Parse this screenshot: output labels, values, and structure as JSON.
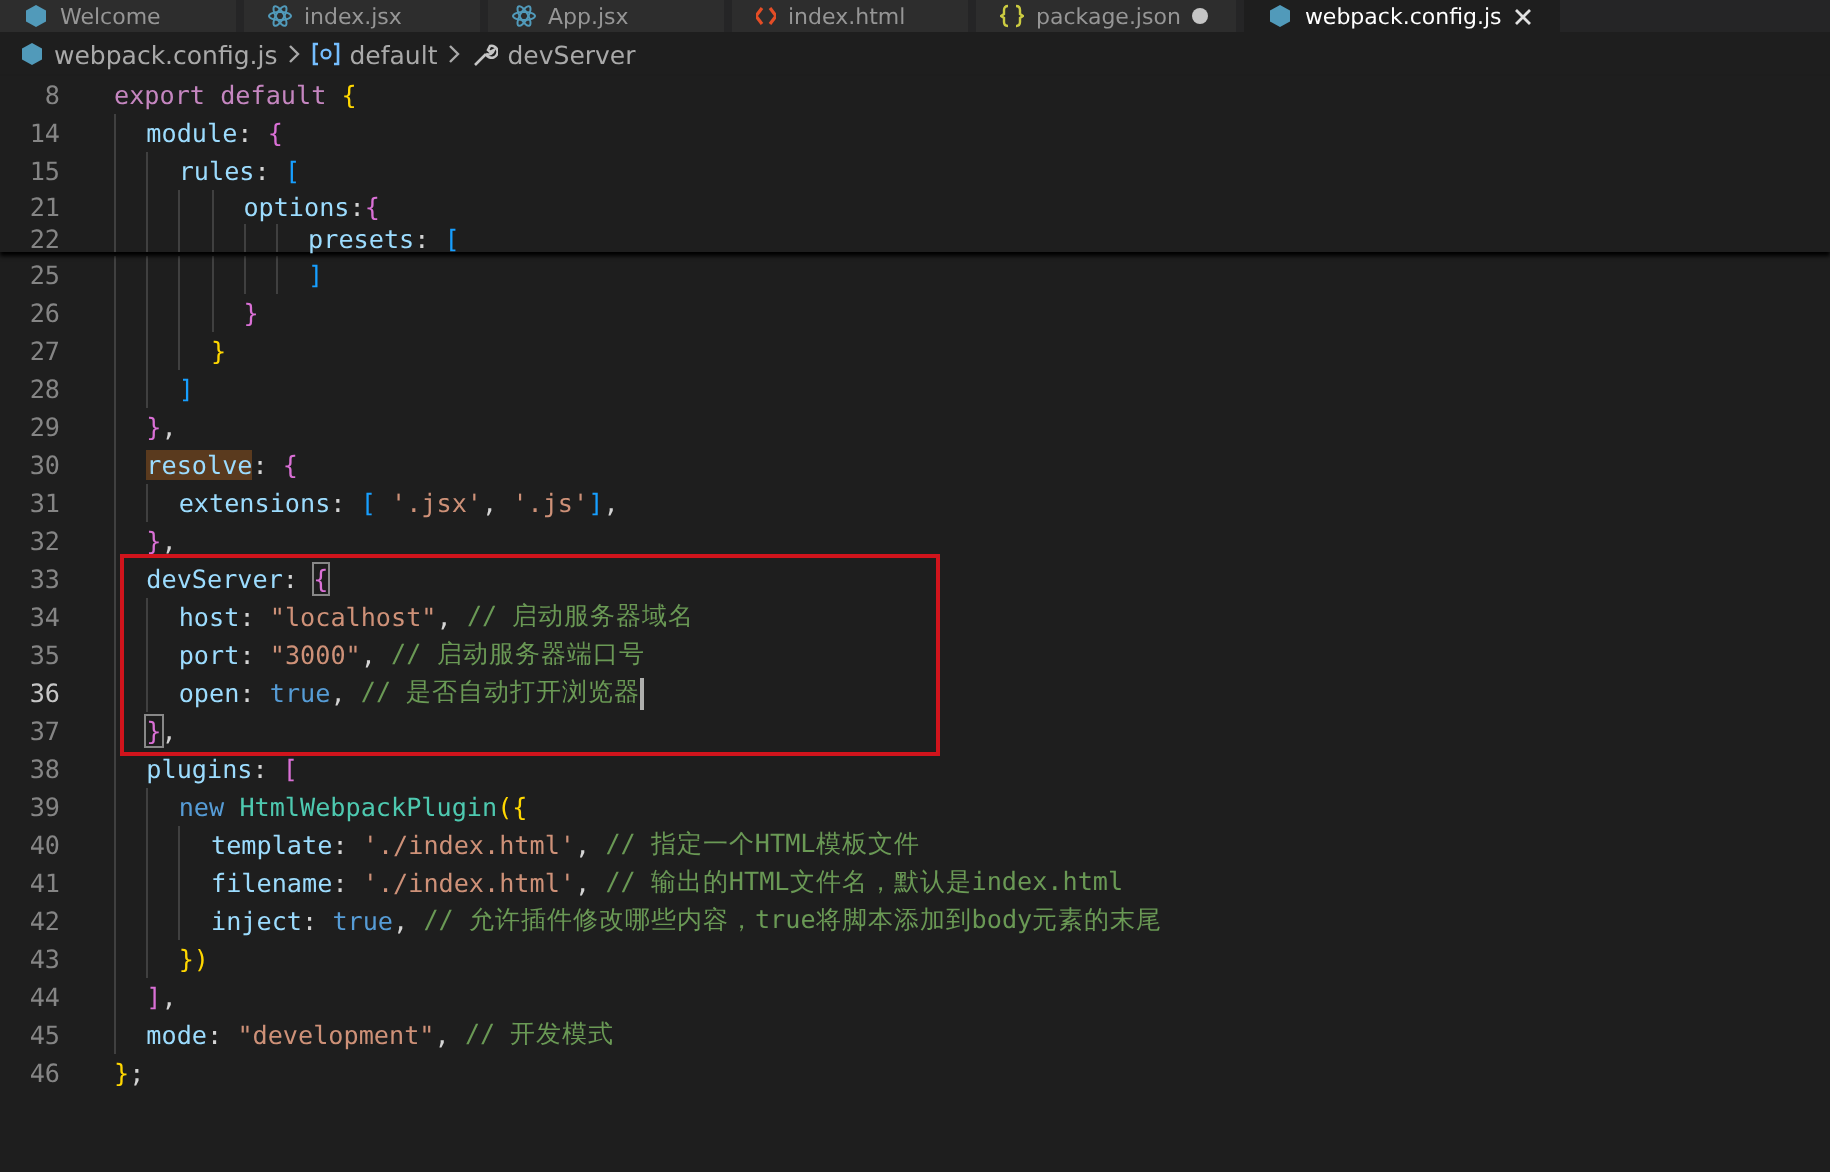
{
  "tabs": [
    {
      "label": "Welcome",
      "kind": "welcome",
      "selected": false,
      "modified": false
    },
    {
      "label": "index.jsx",
      "kind": "react",
      "selected": false,
      "modified": false
    },
    {
      "label": "App.jsx",
      "kind": "react",
      "selected": false,
      "modified": false
    },
    {
      "label": "index.html",
      "kind": "html",
      "selected": false,
      "modified": false
    },
    {
      "label": "package.json",
      "kind": "json",
      "selected": false,
      "modified": true
    },
    {
      "label": "webpack.config.js",
      "kind": "config",
      "selected": true,
      "modified": false
    }
  ],
  "breadcrumb": [
    {
      "label": "webpack.config.js",
      "kind": "file"
    },
    {
      "label": "default",
      "kind": "symbol"
    },
    {
      "label": "devServer",
      "kind": "wrench"
    }
  ],
  "sticky_lines": [
    {
      "number": "8",
      "active": false,
      "tokens": [
        {
          "kind": "kw",
          "text": "export default "
        },
        {
          "kind": "b1",
          "text": "{"
        }
      ]
    },
    {
      "number": "14",
      "active": false,
      "tokens": [
        {
          "kind": "prop",
          "text": "  module"
        },
        {
          "kind": "p",
          "text": ": "
        },
        {
          "kind": "b2",
          "text": "{"
        }
      ]
    },
    {
      "number": "15",
      "active": false,
      "tokens": [
        {
          "kind": "prop",
          "text": "    rules"
        },
        {
          "kind": "p",
          "text": ": "
        },
        {
          "kind": "b3",
          "text": "["
        }
      ]
    },
    {
      "number": "21",
      "active": false,
      "tokens": [
        {
          "kind": "prop",
          "text": "        options"
        },
        {
          "kind": "p",
          "text": ":"
        },
        {
          "kind": "b2",
          "text": "{"
        }
      ]
    },
    {
      "number": "22",
      "active": false,
      "tokens": [
        {
          "kind": "prop",
          "text": "            presets"
        },
        {
          "kind": "p",
          "text": ": "
        },
        {
          "kind": "b3",
          "text": "["
        }
      ]
    }
  ],
  "lines": [
    {
      "number": "25",
      "active": false,
      "framed": false,
      "tokens": [
        {
          "kind": "b3",
          "text": "            ]"
        }
      ]
    },
    {
      "number": "26",
      "active": false,
      "framed": false,
      "tokens": [
        {
          "kind": "b2",
          "text": "        }"
        }
      ]
    },
    {
      "number": "27",
      "active": false,
      "framed": false,
      "tokens": [
        {
          "kind": "b1",
          "text": "      }"
        }
      ]
    },
    {
      "number": "28",
      "active": false,
      "framed": false,
      "tokens": [
        {
          "kind": "b3",
          "text": "    ]"
        }
      ]
    },
    {
      "number": "29",
      "active": false,
      "framed": false,
      "tokens": [
        {
          "kind": "b2",
          "text": "  }"
        },
        {
          "kind": "p",
          "text": ","
        }
      ]
    },
    {
      "number": "30",
      "active": false,
      "framed": false,
      "tokens": [
        {
          "kind": "match",
          "text": "  resolve"
        },
        {
          "kind": "p",
          "text": ": "
        },
        {
          "kind": "b2",
          "text": "{"
        }
      ]
    },
    {
      "number": "31",
      "active": false,
      "framed": false,
      "tokens": [
        {
          "kind": "prop",
          "text": "    extensions"
        },
        {
          "kind": "p",
          "text": ": "
        },
        {
          "kind": "b3",
          "text": "["
        },
        {
          "kind": "str",
          "text": " '.jsx'"
        },
        {
          "kind": "p",
          "text": ", "
        },
        {
          "kind": "str",
          "text": "'.js'"
        },
        {
          "kind": "b3",
          "text": "]"
        },
        {
          "kind": "p",
          "text": ","
        }
      ]
    },
    {
      "number": "32",
      "active": false,
      "framed": false,
      "tokens": [
        {
          "kind": "b2",
          "text": "  }"
        },
        {
          "kind": "p",
          "text": ","
        }
      ]
    },
    {
      "number": "33",
      "active": false,
      "framed": true,
      "tokens": [
        {
          "kind": "prop",
          "text": "  devServer"
        },
        {
          "kind": "p",
          "text": ": "
        },
        {
          "kind": "b2m",
          "text": "{"
        }
      ]
    },
    {
      "number": "34",
      "active": false,
      "framed": true,
      "tokens": [
        {
          "kind": "prop",
          "text": "    host"
        },
        {
          "kind": "p",
          "text": ": "
        },
        {
          "kind": "str",
          "text": "\"localhost\""
        },
        {
          "kind": "p",
          "text": ", "
        },
        {
          "kind": "com",
          "text": "// 启动服务器域名"
        }
      ]
    },
    {
      "number": "35",
      "active": false,
      "framed": true,
      "tokens": [
        {
          "kind": "prop",
          "text": "    port"
        },
        {
          "kind": "p",
          "text": ": "
        },
        {
          "kind": "str",
          "text": "\"3000\""
        },
        {
          "kind": "p",
          "text": ", "
        },
        {
          "kind": "com",
          "text": "// 启动服务器端口号"
        }
      ]
    },
    {
      "number": "36",
      "active": true,
      "framed": true,
      "tokens": [
        {
          "kind": "prop",
          "text": "    open"
        },
        {
          "kind": "p",
          "text": ": "
        },
        {
          "kind": "bool",
          "text": "true"
        },
        {
          "kind": "p",
          "text": ", "
        },
        {
          "kind": "com",
          "text": "// 是否自动打开浏览器"
        }
      ]
    },
    {
      "number": "37",
      "active": false,
      "framed": true,
      "tokens": [
        {
          "kind": "b2m",
          "text": "  }"
        },
        {
          "kind": "p",
          "text": ","
        }
      ]
    },
    {
      "number": "38",
      "active": false,
      "framed": false,
      "tokens": [
        {
          "kind": "prop",
          "text": "  plugins"
        },
        {
          "kind": "p",
          "text": ": "
        },
        {
          "kind": "b2",
          "text": "["
        }
      ]
    },
    {
      "number": "39",
      "active": false,
      "framed": false,
      "tokens": [
        {
          "kind": "bool",
          "text": "    new "
        },
        {
          "kind": "cls",
          "text": "HtmlWebpackPlugin"
        },
        {
          "kind": "b1",
          "text": "({"
        }
      ]
    },
    {
      "number": "40",
      "active": false,
      "framed": false,
      "tokens": [
        {
          "kind": "prop",
          "text": "      template"
        },
        {
          "kind": "p",
          "text": ": "
        },
        {
          "kind": "str",
          "text": "'./index.html'"
        },
        {
          "kind": "p",
          "text": ", "
        },
        {
          "kind": "com",
          "text": "// 指定一个HTML模板文件"
        }
      ]
    },
    {
      "number": "41",
      "active": false,
      "framed": false,
      "tokens": [
        {
          "kind": "prop",
          "text": "      filename"
        },
        {
          "kind": "p",
          "text": ": "
        },
        {
          "kind": "str",
          "text": "'./index.html'"
        },
        {
          "kind": "p",
          "text": ", "
        },
        {
          "kind": "com",
          "text": "// 输出的HTML文件名，默认是index.html"
        }
      ]
    },
    {
      "number": "42",
      "active": false,
      "framed": false,
      "tokens": [
        {
          "kind": "prop",
          "text": "      inject"
        },
        {
          "kind": "p",
          "text": ": "
        },
        {
          "kind": "bool",
          "text": "true"
        },
        {
          "kind": "p",
          "text": ", "
        },
        {
          "kind": "com",
          "text": "// 允许插件修改哪些内容，true将脚本添加到body元素的末尾"
        }
      ]
    },
    {
      "number": "43",
      "active": false,
      "framed": false,
      "tokens": [
        {
          "kind": "b1",
          "text": "    })"
        }
      ]
    },
    {
      "number": "44",
      "active": false,
      "framed": false,
      "tokens": [
        {
          "kind": "b2",
          "text": "  ]"
        },
        {
          "kind": "p",
          "text": ","
        }
      ]
    },
    {
      "number": "45",
      "active": false,
      "framed": false,
      "tokens": [
        {
          "kind": "prop",
          "text": "  mode"
        },
        {
          "kind": "p",
          "text": ": "
        },
        {
          "kind": "str",
          "text": "\"development\""
        },
        {
          "kind": "p",
          "text": ", "
        },
        {
          "kind": "com",
          "text": "// 开发模式"
        }
      ]
    },
    {
      "number": "46",
      "active": false,
      "framed": false,
      "tokens": [
        {
          "kind": "b1",
          "text": "}"
        },
        {
          "kind": "p",
          "text": ";"
        }
      ]
    }
  ]
}
